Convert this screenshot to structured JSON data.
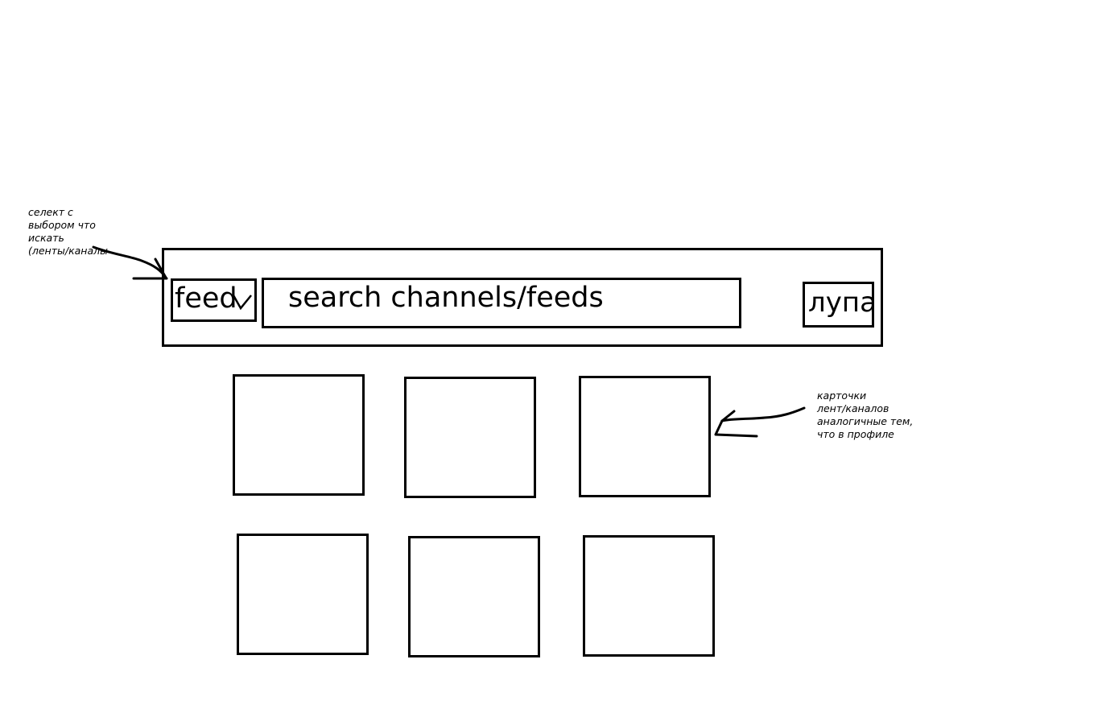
{
  "annotations": {
    "select_note": [
      "селект с",
      "выбором что",
      "искать",
      "(ленты/каналы"
    ],
    "cards_note": [
      "карточки",
      "лент/каналов",
      "аналогичные тем,",
      "что в профиле"
    ]
  },
  "search_bar": {
    "select_value": "feed",
    "select_icon": "chevron-down-icon",
    "input_text": "search channels/feeds",
    "search_button_label": "лупа"
  },
  "cards_grid": {
    "rows": 2,
    "columns": 3
  }
}
